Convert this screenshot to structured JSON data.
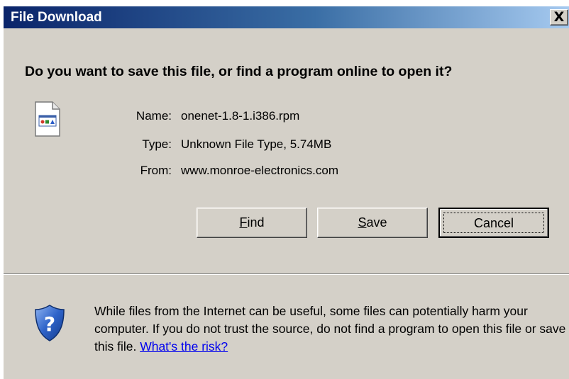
{
  "window": {
    "title": "File Download",
    "close_label": "X"
  },
  "prompt": {
    "question": "Do you want to save this file, or find a program online to open it?"
  },
  "file_info": {
    "icon": "unknown-file-icon",
    "name_label": "Name:",
    "name_value": "onenet-1.8-1.i386.rpm",
    "type_label": "Type:",
    "type_value": "Unknown File Type, 5.74MB",
    "from_label": "From:",
    "from_value": "www.monroe-electronics.com"
  },
  "buttons": {
    "find": "Find",
    "save": "Save",
    "cancel": "Cancel"
  },
  "warning": {
    "icon": "shield-question-icon",
    "text": "While files from the Internet can be useful, some files can potentially harm your computer. If you do not trust the source, do not find a program to open this file or save this file.",
    "link": "What's the risk?"
  },
  "colors": {
    "title_gradient_start": "#0a246a",
    "title_gradient_end": "#a6caf0",
    "dialog_bg": "#d4d0c8",
    "link": "#0000ee"
  }
}
